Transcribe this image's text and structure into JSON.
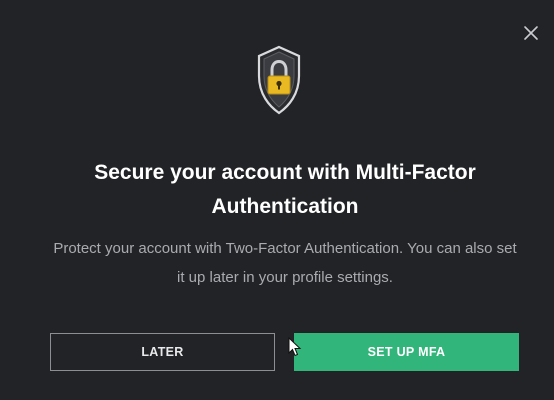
{
  "modal": {
    "close_icon": "close-icon",
    "header_icon": "shield-lock-icon",
    "title": "Secure your account with Multi-Factor Authentication",
    "description": "Protect your account with Two-Factor Authentication. You can also set it up later in your profile settings.",
    "later_label": "LATER",
    "setup_label": "SET UP MFA"
  },
  "colors": {
    "background": "#222326",
    "accent": "#31b57a",
    "shield_gold": "#e8b923",
    "muted_text": "#a9abb0"
  }
}
